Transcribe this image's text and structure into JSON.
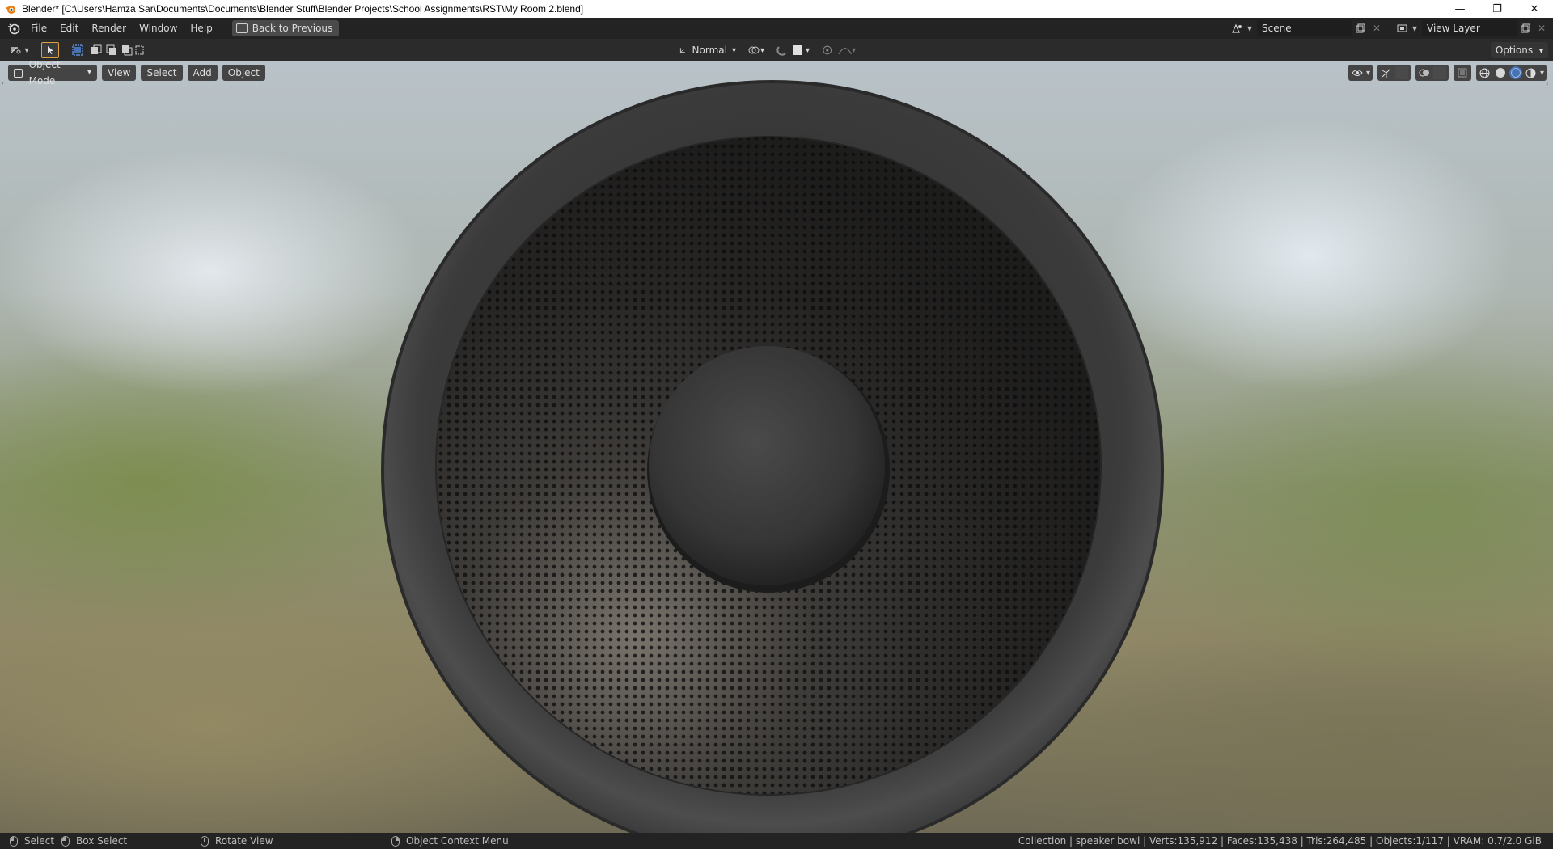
{
  "window": {
    "title": "Blender* [C:\\Users\\Hamza Sar\\Documents\\Documents\\Blender Stuff\\Blender Projects\\School Assignments\\RST\\My Room 2.blend]",
    "minimize": "—",
    "maximize": "❐",
    "close": "✕"
  },
  "menu": {
    "items": [
      "File",
      "Edit",
      "Render",
      "Window",
      "Help"
    ],
    "back_label": "Back to Previous"
  },
  "scene": {
    "name": "Scene",
    "view_layer": "View Layer"
  },
  "tool_header": {
    "orientation": "Normal",
    "options_label": "Options"
  },
  "viewport_header": {
    "mode": "Object Mode",
    "menus": [
      "View",
      "Select",
      "Add",
      "Object"
    ]
  },
  "status_bar": {
    "select": "Select",
    "box_select": "Box Select",
    "rotate_view": "Rotate View",
    "context_menu": "Object Context Menu",
    "stats": "Collection | speaker bowl | Verts:135,912 | Faces:135,438 | Tris:264,485 | Objects:1/117 | VRAM: 0.7/2.0 GiB"
  },
  "colors": {
    "accent": "#4772b3",
    "header_bg": "#2b2b2b",
    "topbar_bg": "#232323"
  },
  "icons": [
    "blender-logo",
    "editor-type-icon",
    "select-cursor-icon",
    "box-select-mode-icons",
    "transform-orientation-icon",
    "pivot-icon",
    "snap-icon",
    "proportional-edit-icon",
    "visibility-icon",
    "gizmo-icon",
    "overlay-icon",
    "xray-icon",
    "wireframe-shading",
    "solid-shading",
    "material-preview-shading",
    "rendered-shading"
  ]
}
